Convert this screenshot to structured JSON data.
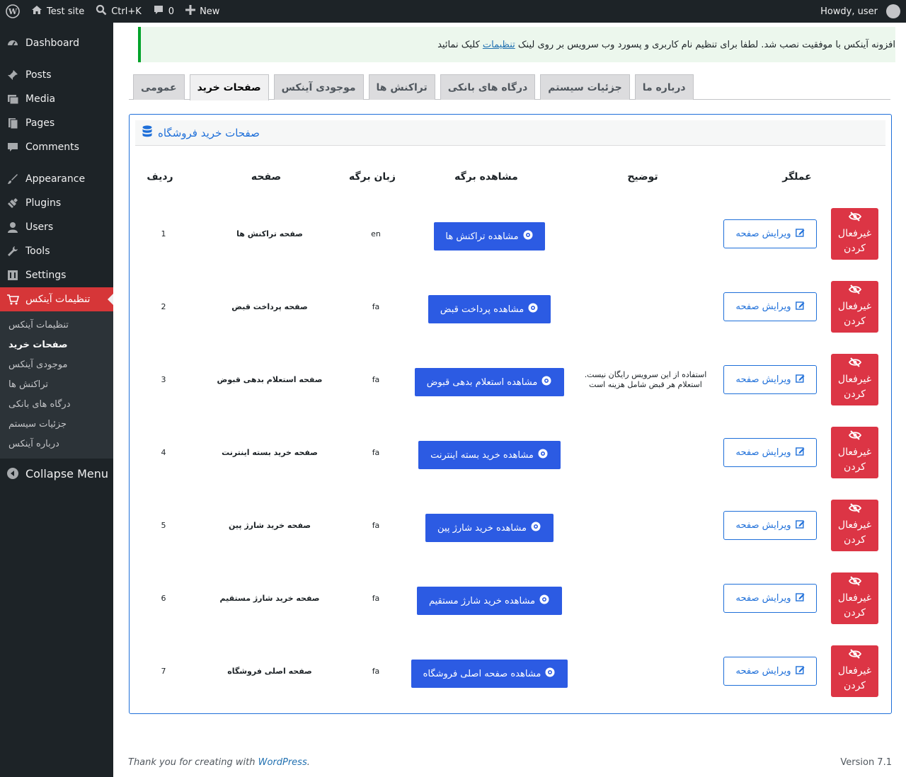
{
  "adminbar": {
    "site_name": "Test site",
    "search_shortcut": "Ctrl+K",
    "comments_count": "0",
    "new_label": "New",
    "howdy": "Howdy, user"
  },
  "sidebar": {
    "items": [
      {
        "label": "Dashboard",
        "icon": "dashboard-icon"
      },
      {
        "label": "Posts",
        "icon": "pin-icon"
      },
      {
        "label": "Media",
        "icon": "media-icon"
      },
      {
        "label": "Pages",
        "icon": "pages-icon"
      },
      {
        "label": "Comments",
        "icon": "comment-icon"
      },
      {
        "label": "Appearance",
        "icon": "brush-icon"
      },
      {
        "label": "Plugins",
        "icon": "plugin-icon"
      },
      {
        "label": "Users",
        "icon": "user-icon"
      },
      {
        "label": "Tools",
        "icon": "wrench-icon"
      },
      {
        "label": "Settings",
        "icon": "settings-icon"
      },
      {
        "label": "تنظیمات آینکس",
        "icon": "cart-icon"
      }
    ],
    "submenu": [
      "تنظیمات آینکس",
      "صفحات خرید",
      "موجودی آینکس",
      "تراکنش ها",
      "درگاه های بانکی",
      "جزئیات سیستم",
      "درباره آینکس"
    ],
    "collapse_label": "Collapse Menu"
  },
  "notice": {
    "text_before": "افزونه آینکس با موفقیت نصب شد. لطفا برای تنظیم نام کاربری و پسورد وب سرویس بر روی لینک",
    "link": "تنظیمات",
    "text_after": "کلیک نمائید"
  },
  "tabs": [
    "عمومی",
    "صفحات خرید",
    "موجودی آینکس",
    "تراکنش ها",
    "درگاه های بانکی",
    "جزئیات سیستم",
    "درباره ما"
  ],
  "panel": {
    "title": "صفحات خرید فروشگاه",
    "headers": {
      "row_no": "ردیف",
      "page": "صفحه",
      "language": "زبان برگه",
      "view": "مشاهده برگه",
      "description": "توضیح",
      "action": "عملگر"
    },
    "edit_label": "ویرایش صفحه",
    "disable_line1": "غیرفعال",
    "disable_line2": "کردن",
    "rows": [
      {
        "no": "1",
        "page": "صفحه تراکنش ها",
        "lang": "en",
        "view": "مشاهده تراکنش ها",
        "desc1": "",
        "desc2": ""
      },
      {
        "no": "2",
        "page": "صفحه پرداخت قبض",
        "lang": "fa",
        "view": "مشاهده پرداخت قبض",
        "desc1": "",
        "desc2": ""
      },
      {
        "no": "3",
        "page": "صفحه استعلام بدهی قبوض",
        "lang": "fa",
        "view": "مشاهده استعلام بدهی قبوض",
        "desc1": "استفاده از این سرویس رایگان نیست.",
        "desc2": "استعلام هر قبض شامل هزینه است"
      },
      {
        "no": "4",
        "page": "صفحه خرید بسته اینترنت",
        "lang": "fa",
        "view": "مشاهده خرید بسته اینترنت",
        "desc1": "",
        "desc2": ""
      },
      {
        "no": "5",
        "page": "صفحه خرید شارژ پین",
        "lang": "fa",
        "view": "مشاهده خرید شارژ پین",
        "desc1": "",
        "desc2": ""
      },
      {
        "no": "6",
        "page": "صفحه خرید شارژ مستقیم",
        "lang": "fa",
        "view": "مشاهده خرید شارژ مستقیم",
        "desc1": "",
        "desc2": ""
      },
      {
        "no": "7",
        "page": "صفحه اصلی فروشگاه",
        "lang": "fa",
        "view": "مشاهده صفحه اصلی فروشگاه",
        "desc1": "",
        "desc2": ""
      }
    ]
  },
  "footer": {
    "thanks_before": "Thank you for creating with",
    "thanks_link": "WordPress",
    "thanks_after": ".",
    "version": "Version 7.1"
  }
}
